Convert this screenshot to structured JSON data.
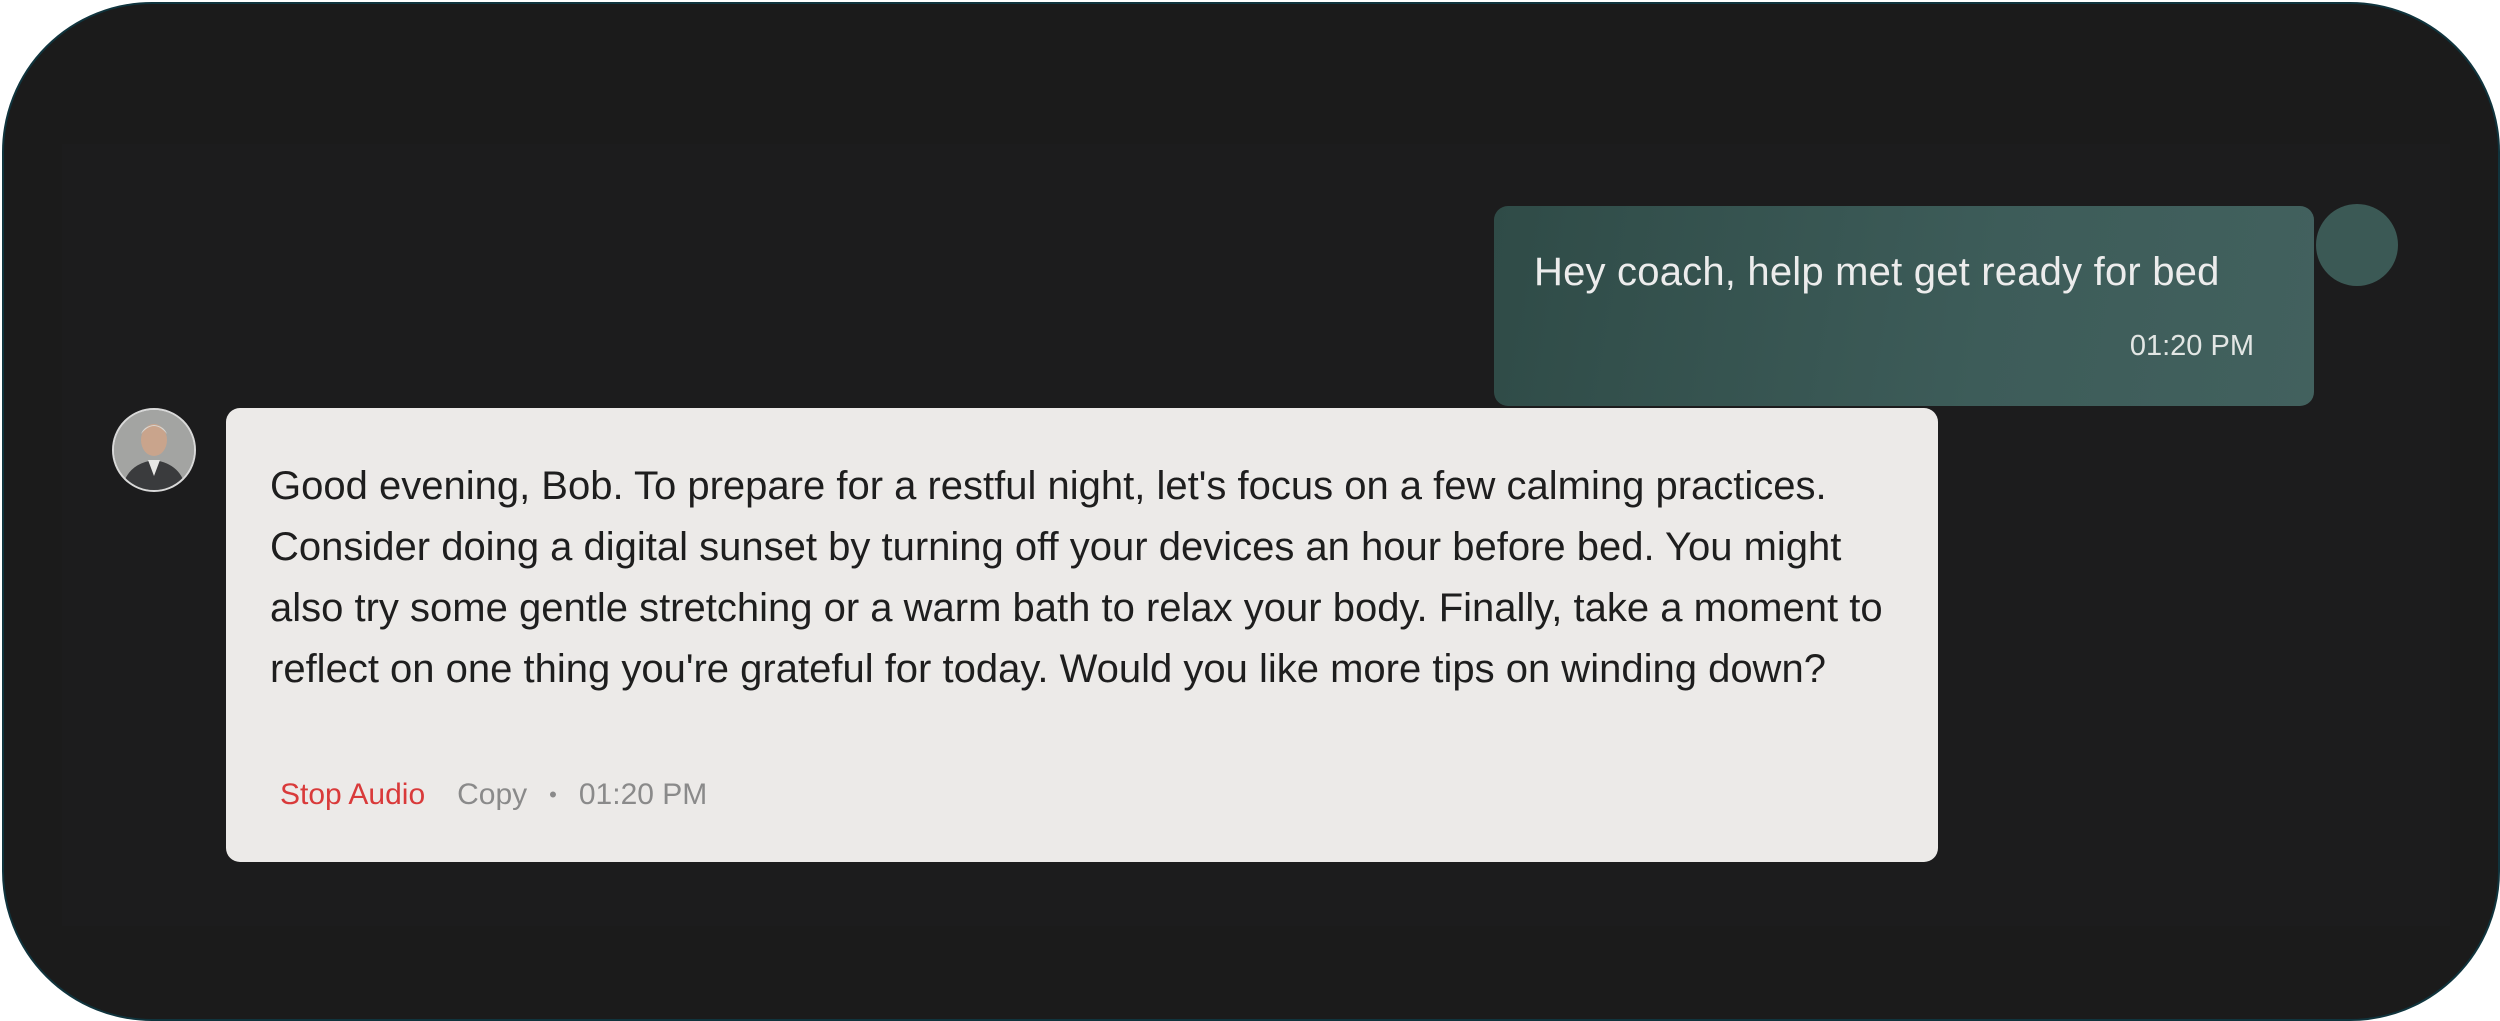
{
  "conversation": {
    "user_message": {
      "text": "Hey coach, help met get ready for bed",
      "time": "01:20 PM"
    },
    "coach_message": {
      "text": "Good evening, Bob. To prepare for a restful night, let's focus on a few calming practices. Consider doing a digital sunset by turning off your devices an hour before bed. You might also try some gentle stretching or a warm bath to relax your body. Finally, take a moment to reflect on one thing you're grateful for today. Would you like more tips on winding down?",
      "stop_audio_label": "Stop Audio",
      "copy_label": "Copy",
      "separator": "•",
      "time": "01:20 PM"
    }
  },
  "colors": {
    "background": "#1b1b1b",
    "user_bubble": "#3d5c59",
    "coach_bubble": "#eceae8",
    "stop_audio": "#d93a3a",
    "muted_text": "#8a8a8a"
  },
  "icons": {
    "user_avatar": "avatar-placeholder",
    "coach_avatar": "coach-portrait"
  }
}
